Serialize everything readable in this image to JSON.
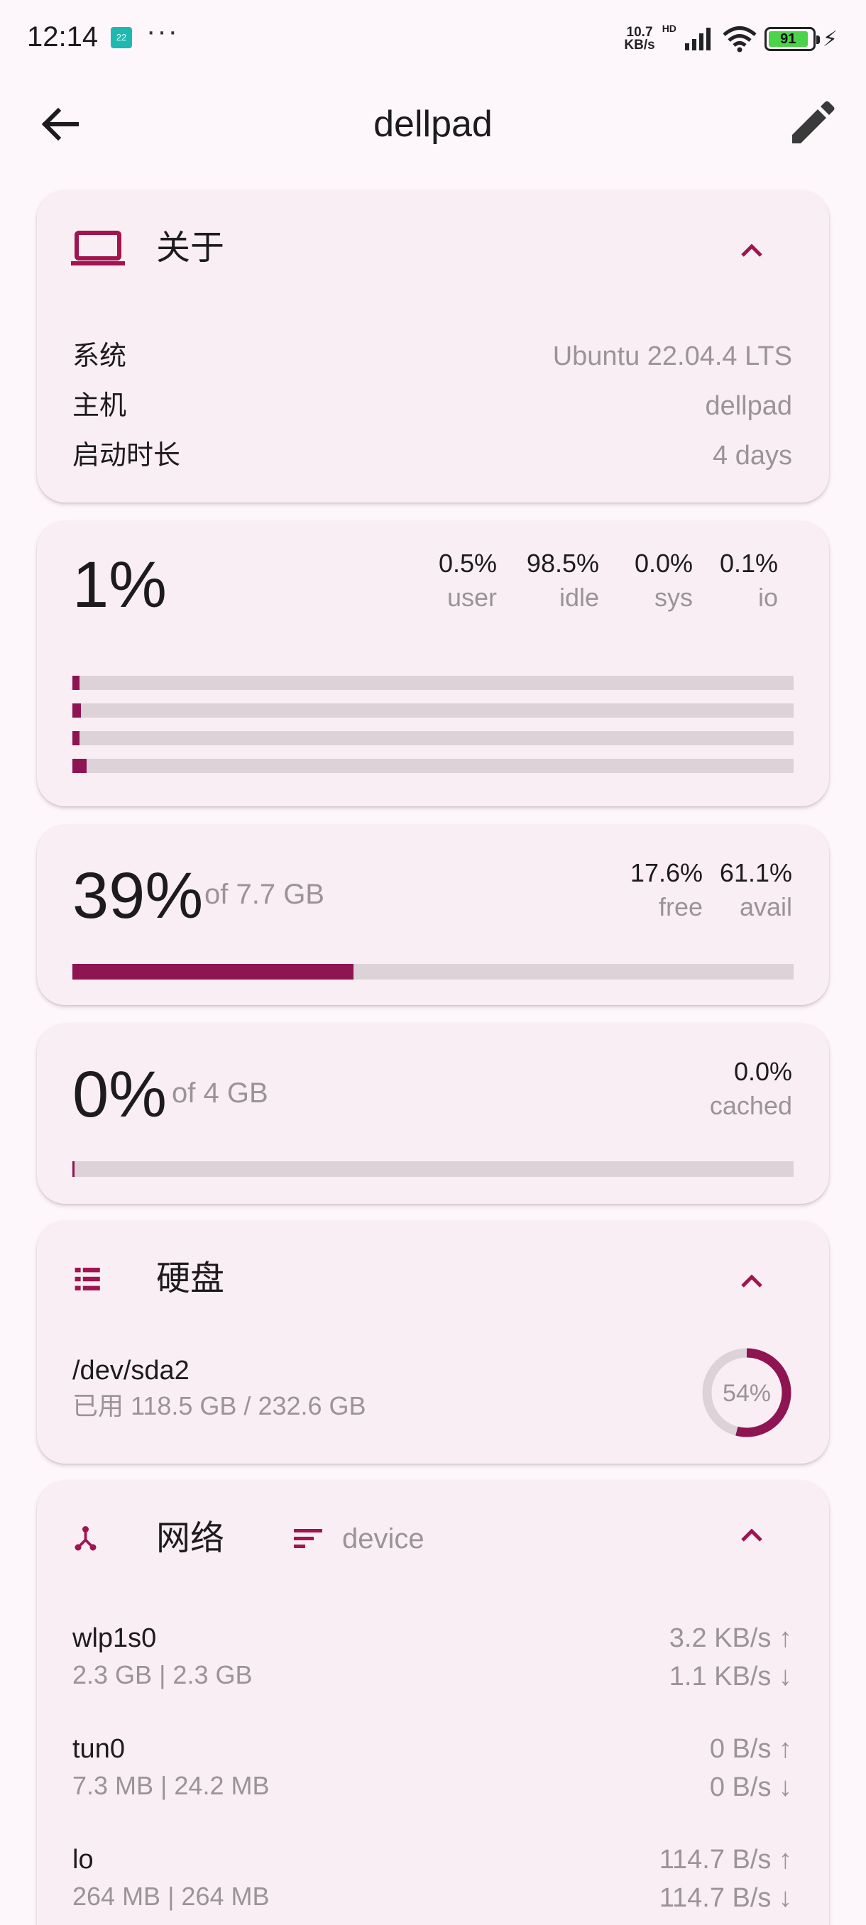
{
  "status_bar": {
    "time": "12:14",
    "notif_badge": "22",
    "more": "···",
    "net_speed_value": "10.7",
    "net_speed_unit": "KB/s",
    "signal_label": "HD",
    "battery_level": "91",
    "battery_fill_fraction": 0.91,
    "battery_color": "#4cd34a"
  },
  "app_bar": {
    "title": "dellpad",
    "back_icon": "arrow-left-icon",
    "edit_icon": "pencil-icon"
  },
  "colors": {
    "accent": "#a1144f",
    "bar_fill": "#8e1452",
    "bar_track": "#dcd2d8",
    "card": "#f8eef4",
    "background": "#fdf7fb",
    "muted": "#9c9398"
  },
  "about": {
    "title": "关于",
    "icon": "laptop-icon",
    "rows": [
      {
        "key": "系统",
        "value": "Ubuntu 22.04.4 LTS"
      },
      {
        "key": "主机",
        "value": "dellpad"
      },
      {
        "key": "启动时长",
        "value": "4 days"
      }
    ]
  },
  "cpu": {
    "percent": "1%",
    "stats": [
      {
        "value": "0.5%",
        "label": "user"
      },
      {
        "value": "98.5%",
        "label": "idle"
      },
      {
        "value": "0.0%",
        "label": "sys"
      },
      {
        "value": "0.1%",
        "label": "io"
      }
    ],
    "core_usage": [
      0.01,
      0.012,
      0.01,
      0.02
    ]
  },
  "memory": {
    "percent": "39%",
    "of_text": "of 7.7 GB",
    "usage_fraction": 0.39,
    "stats": [
      {
        "value": "17.6%",
        "label": "free"
      },
      {
        "value": "61.1%",
        "label": "avail"
      }
    ]
  },
  "swap": {
    "percent": "0%",
    "of_text": "of 4 GB",
    "usage_fraction": 0.0,
    "stats": [
      {
        "value": "0.0%",
        "label": "cached"
      }
    ]
  },
  "disk": {
    "title": "硬盘",
    "icon": "storage-list-icon",
    "items": [
      {
        "name": "/dev/sda2",
        "used": "已用 118.5 GB / 232.6 GB",
        "percent": "54%",
        "usage_fraction": 0.54
      }
    ]
  },
  "network": {
    "title": "网络",
    "icon": "network-hub-icon",
    "sort_icon": "sort-icon",
    "sort_label": "device",
    "items": [
      {
        "name": "wlp1s0",
        "total": "2.3 GB | 2.3 GB",
        "up": "3.2 KB/s ↑",
        "down": "1.1 KB/s ↓"
      },
      {
        "name": "tun0",
        "total": "7.3 MB | 24.2 MB",
        "up": "0 B/s ↑",
        "down": "0 B/s ↓"
      },
      {
        "name": "lo",
        "total": "264 MB | 264 MB",
        "up": "114.7 B/s ↑",
        "down": "114.7 B/s ↓"
      }
    ]
  }
}
